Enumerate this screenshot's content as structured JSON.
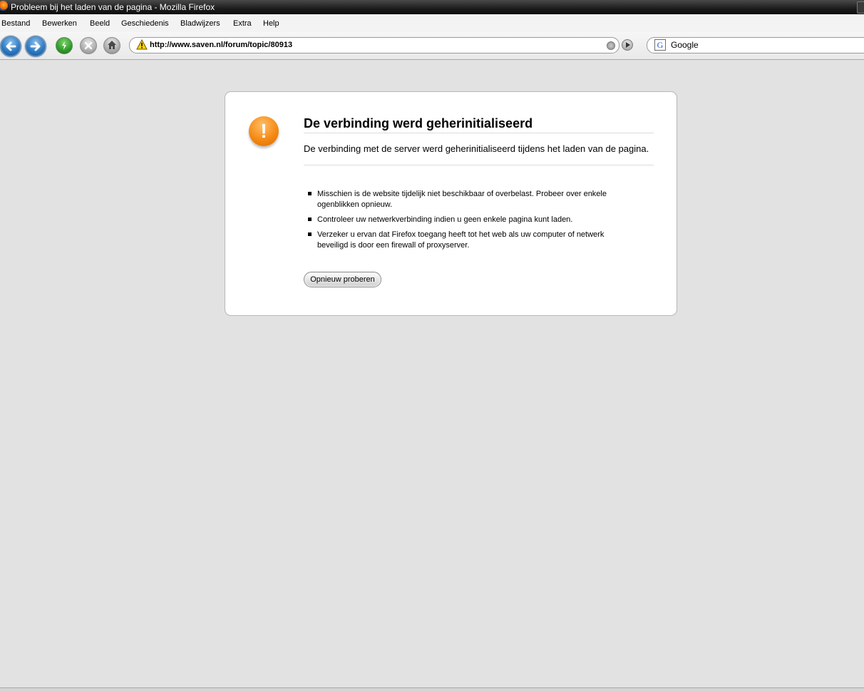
{
  "window": {
    "title": "Probleem bij het laden van de pagina - Mozilla Firefox"
  },
  "menu": {
    "items": [
      {
        "label": "Bestand"
      },
      {
        "label": "Bewerken"
      },
      {
        "label": "Beeld"
      },
      {
        "label": "Geschiedenis"
      },
      {
        "label": "Bladwijzers"
      },
      {
        "label": "Extra"
      },
      {
        "label": "Help"
      }
    ]
  },
  "toolbar": {
    "url": "http://www.saven.nl/forum/topic/80913",
    "search_engine": "Google",
    "icons": [
      "back-icon",
      "forward-icon",
      "reload-icon",
      "stop-icon",
      "home-icon",
      "warning-icon",
      "go-icon",
      "google-icon"
    ]
  },
  "error": {
    "title": "De verbinding werd geherinitialiseerd",
    "description": "De verbinding met de server werd geherinitialiseerd tijdens het laden van de pagina.",
    "tips": [
      "Misschien is de website tijdelijk niet beschikbaar of overbelast. Probeer over enkele ogenblikken opnieuw.",
      "Controleer uw netwerkverbinding indien u geen enkele pagina kunt laden.",
      "Verzeker u ervan dat Firefox toegang heeft tot het web als uw computer of netwerk beveiligd is door een firewall of proxyserver."
    ],
    "retry_label": "Opnieuw proberen",
    "icon": "!"
  },
  "colors": {
    "background": "#e2e2e2",
    "alert_orange": "#f58a16"
  }
}
